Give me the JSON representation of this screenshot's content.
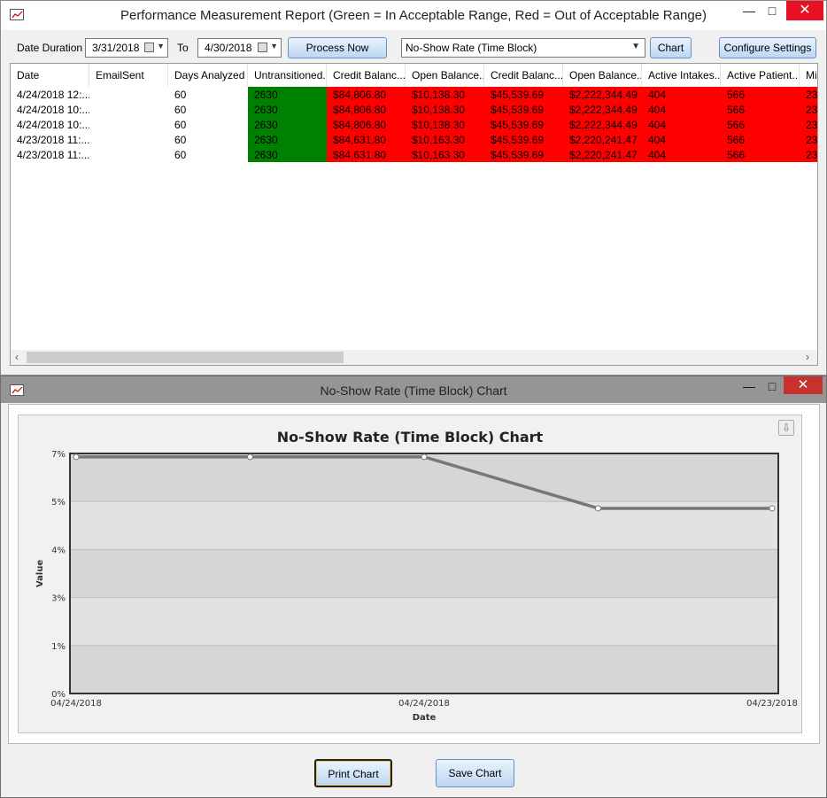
{
  "main_window": {
    "title": "Performance Measurement Report (Green = In Acceptable Range, Red = Out of Acceptable Range)",
    "toolbar": {
      "date_duration_label": "Date Duration",
      "from_date": "3/31/2018",
      "to_label": "To",
      "to_date": "4/30/2018",
      "process_button": "Process Now",
      "metric_selected": "No-Show Rate (Time Block)",
      "chart_button": "Chart",
      "configure_button": "Configure Settings"
    },
    "grid": {
      "columns": [
        "Date",
        "EmailSent",
        "Days Analyzed",
        "Untransitioned...",
        "Credit Balanc...",
        "Open Balance...",
        "Credit Balanc...",
        "Open Balance...",
        "Active Intakes...",
        "Active Patient...",
        "Mi"
      ],
      "rows": [
        [
          "4/24/2018 12:...",
          "",
          "60",
          "2630",
          "$84,806.80",
          "$10,138.30",
          "$45,539.69",
          "$2,222,344.49",
          "404",
          "566",
          "23"
        ],
        [
          "4/24/2018 10:...",
          "",
          "60",
          "2630",
          "$84,806.80",
          "$10,138.30",
          "$45,539.69",
          "$2,222,344.49",
          "404",
          "566",
          "23"
        ],
        [
          "4/24/2018 10:...",
          "",
          "60",
          "2630",
          "$84,806.80",
          "$10,138.30",
          "$45,539.69",
          "$2,222,344.49",
          "404",
          "566",
          "23"
        ],
        [
          "4/23/2018 11:...",
          "",
          "60",
          "2630",
          "$84,631.80",
          "$10,163.30",
          "$45,539.69",
          "$2,220,241.47",
          "404",
          "566",
          "23"
        ],
        [
          "4/23/2018 11:...",
          "",
          "60",
          "2630",
          "$84,631.80",
          "$10,163.30",
          "$45,539.69",
          "$2,220,241.47",
          "404",
          "566",
          "23"
        ]
      ],
      "cell_status": [
        "none",
        "none",
        "none",
        "green",
        "red",
        "red",
        "red",
        "red",
        "red",
        "red",
        "red"
      ],
      "status_colors": {
        "green": "#008000",
        "red": "#ff0000"
      }
    }
  },
  "chart_window": {
    "title": "No-Show Rate (Time Block) Chart",
    "print_button": "Print Chart",
    "save_button": "Save Chart"
  },
  "chart_data": {
    "type": "line",
    "title": "No-Show Rate (Time Block) Chart",
    "xlabel": "Date",
    "ylabel": "Value",
    "x_tick_labels": [
      "04/24/2018",
      "04/24/2018",
      "04/23/2018"
    ],
    "x_tick_positions": [
      0,
      2,
      4
    ],
    "y_ticks": [
      "0%",
      "1%",
      "3%",
      "4%",
      "5%",
      "7%"
    ],
    "ylim": [
      0,
      7
    ],
    "series": [
      {
        "values": [
          6.9,
          6.9,
          6.9,
          5.4,
          5.4
        ],
        "color": "#777777"
      }
    ],
    "grid": true
  }
}
